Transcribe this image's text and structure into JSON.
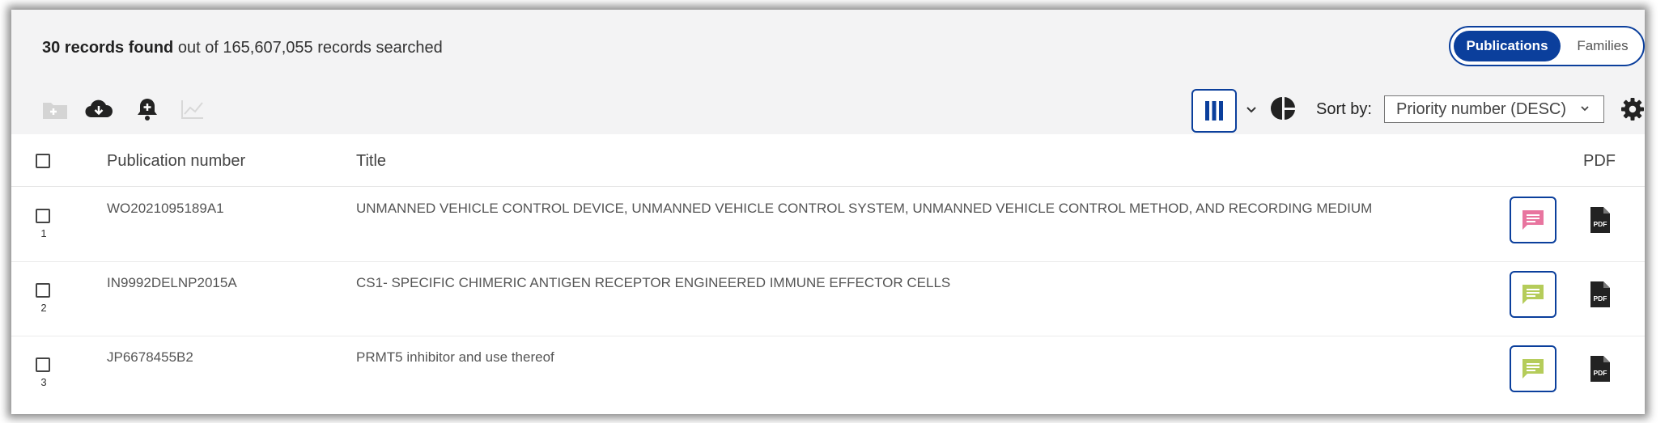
{
  "results": {
    "count_label": "30 records found",
    "searched_label": "out of 165,607,055 records searched"
  },
  "view_toggle": {
    "publications_label": "Publications",
    "families_label": "Families"
  },
  "toolbar": {
    "icons": [
      "add-to-folder-icon",
      "download-icon",
      "add-alert-icon",
      "analytics-chart-icon"
    ],
    "sort_label": "Sort by:",
    "sort_value": "Priority number (DESC)"
  },
  "table": {
    "columns": {
      "publication_number": "Publication number",
      "title": "Title",
      "pdf": "PDF"
    },
    "rows": [
      {
        "index": "1",
        "publication_number": "WO2021095189A1",
        "title": "UNMANNED VEHICLE CONTROL DEVICE, UNMANNED VEHICLE CONTROL SYSTEM, UNMANNED VEHICLE CONTROL METHOD, AND RECORDING MEDIUM",
        "note_color": "#e8759f"
      },
      {
        "index": "2",
        "publication_number": "IN9992DELNP2015A",
        "title": "CS1- SPECIFIC CHIMERIC ANTIGEN RECEPTOR ENGINEERED IMMUNE EFFECTOR CELLS",
        "note_color": "#b5cc5a"
      },
      {
        "index": "3",
        "publication_number": "JP6678455B2",
        "title": "PRMT5 inhibitor and use thereof",
        "note_color": "#b5cc5a"
      }
    ]
  },
  "colors": {
    "accent": "#0b3f9c"
  }
}
